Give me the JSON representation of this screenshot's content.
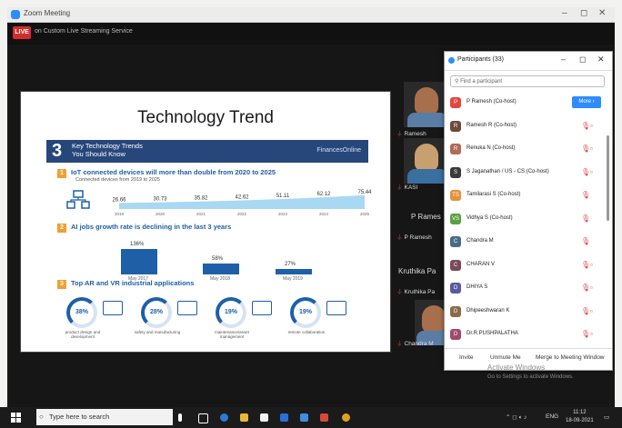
{
  "window": {
    "title": "Zoom Meeting",
    "minimize": "–",
    "maximize": "◻",
    "close": "✕"
  },
  "live": {
    "badge": "LIVE",
    "text": "on Custom Live Streaming Service"
  },
  "slide": {
    "title": "Technology Trend",
    "banner_number": "3",
    "banner_line1": "Key Technology Trends",
    "banner_line2": "You Should Know",
    "banner_logo": "FinancesOnline",
    "section1": {
      "num": "1",
      "title": "IoT connected devices will more than double from 2020 to 2025",
      "sub": "Connected devices from 2019 to 2025",
      "values": [
        "26.66",
        "30.73",
        "35.82",
        "42.62",
        "51.11",
        "62.12",
        "75.44"
      ],
      "years": [
        "2019",
        "2020",
        "2021",
        "2022",
        "2023",
        "2024",
        "2025"
      ]
    },
    "section2": {
      "num": "2",
      "title": "AI jobs growth rate is declining in the last 3 years",
      "bars": [
        {
          "value": "136%",
          "label": "May 2017",
          "v": 136
        },
        {
          "value": "58%",
          "label": "May 2018",
          "v": 58
        },
        {
          "value": "27%",
          "label": "May 2019",
          "v": 27
        }
      ]
    },
    "section3": {
      "num": "3",
      "title": "Top AR and VR industrial applications",
      "items": [
        {
          "pct": "38%",
          "caption": "product design and development",
          "v": 38
        },
        {
          "pct": "28%",
          "caption": "safety and manufacturing",
          "v": 28
        },
        {
          "pct": "19%",
          "caption": "maintenance/asset management",
          "v": 19
        },
        {
          "pct": "19%",
          "caption": "remote collaboration",
          "v": 19
        }
      ]
    }
  },
  "videos": [
    {
      "name": "Ramesh"
    },
    {
      "name": "KASI"
    },
    {
      "name": "P Ramesh"
    },
    {
      "name": "Kruthika Pa"
    },
    {
      "name": "Chandra M"
    }
  ],
  "video_label_right": "P Rames",
  "video_label_kruthika": "Kruthika Pa",
  "participants": {
    "title": "Participants (33)",
    "search_placeholder": "Find a participant",
    "more_label": "More ›",
    "list": [
      {
        "name": "P Ramesh (Co-host)",
        "initial": "P",
        "color": "#e0483e"
      },
      {
        "name": "Ramesh R (Co-host)",
        "initial": "R",
        "color": "#6d4a3a"
      },
      {
        "name": "Renuka N (Co-host)",
        "initial": "R",
        "color": "#b06a5a"
      },
      {
        "name": "S Jaganathan / US - CS (Co-host)",
        "initial": "S",
        "color": "#3a3a3a"
      },
      {
        "name": "Tamilarasi S (Co-host)",
        "initial": "TS",
        "color": "#e6903a"
      },
      {
        "name": "Vidhya S (Co-host)",
        "initial": "VS",
        "color": "#5aa040"
      },
      {
        "name": "Chandra M",
        "initial": "C",
        "color": "#4a6a8a"
      },
      {
        "name": "CHARAN V",
        "initial": "C",
        "color": "#7a4a5a"
      },
      {
        "name": "DHIYA S",
        "initial": "D",
        "color": "#5a5aa0"
      },
      {
        "name": "Dhipeeshwaran K",
        "initial": "D",
        "color": "#8a6a4a"
      },
      {
        "name": "Dr.R.PUSHPALATHA",
        "initial": "D",
        "color": "#a04a6a"
      }
    ],
    "footer": {
      "invite": "Invite",
      "unmute_me": "Unmute Me",
      "merge": "Merge to Meeting Window"
    }
  },
  "watermark": {
    "line1": "Activate Windows",
    "line2": "Go to Settings to activate Windows."
  },
  "taskbar": {
    "search_placeholder": "Type here to search",
    "time": "11:12",
    "date": "18-09-2021",
    "lang": "ENG"
  }
}
